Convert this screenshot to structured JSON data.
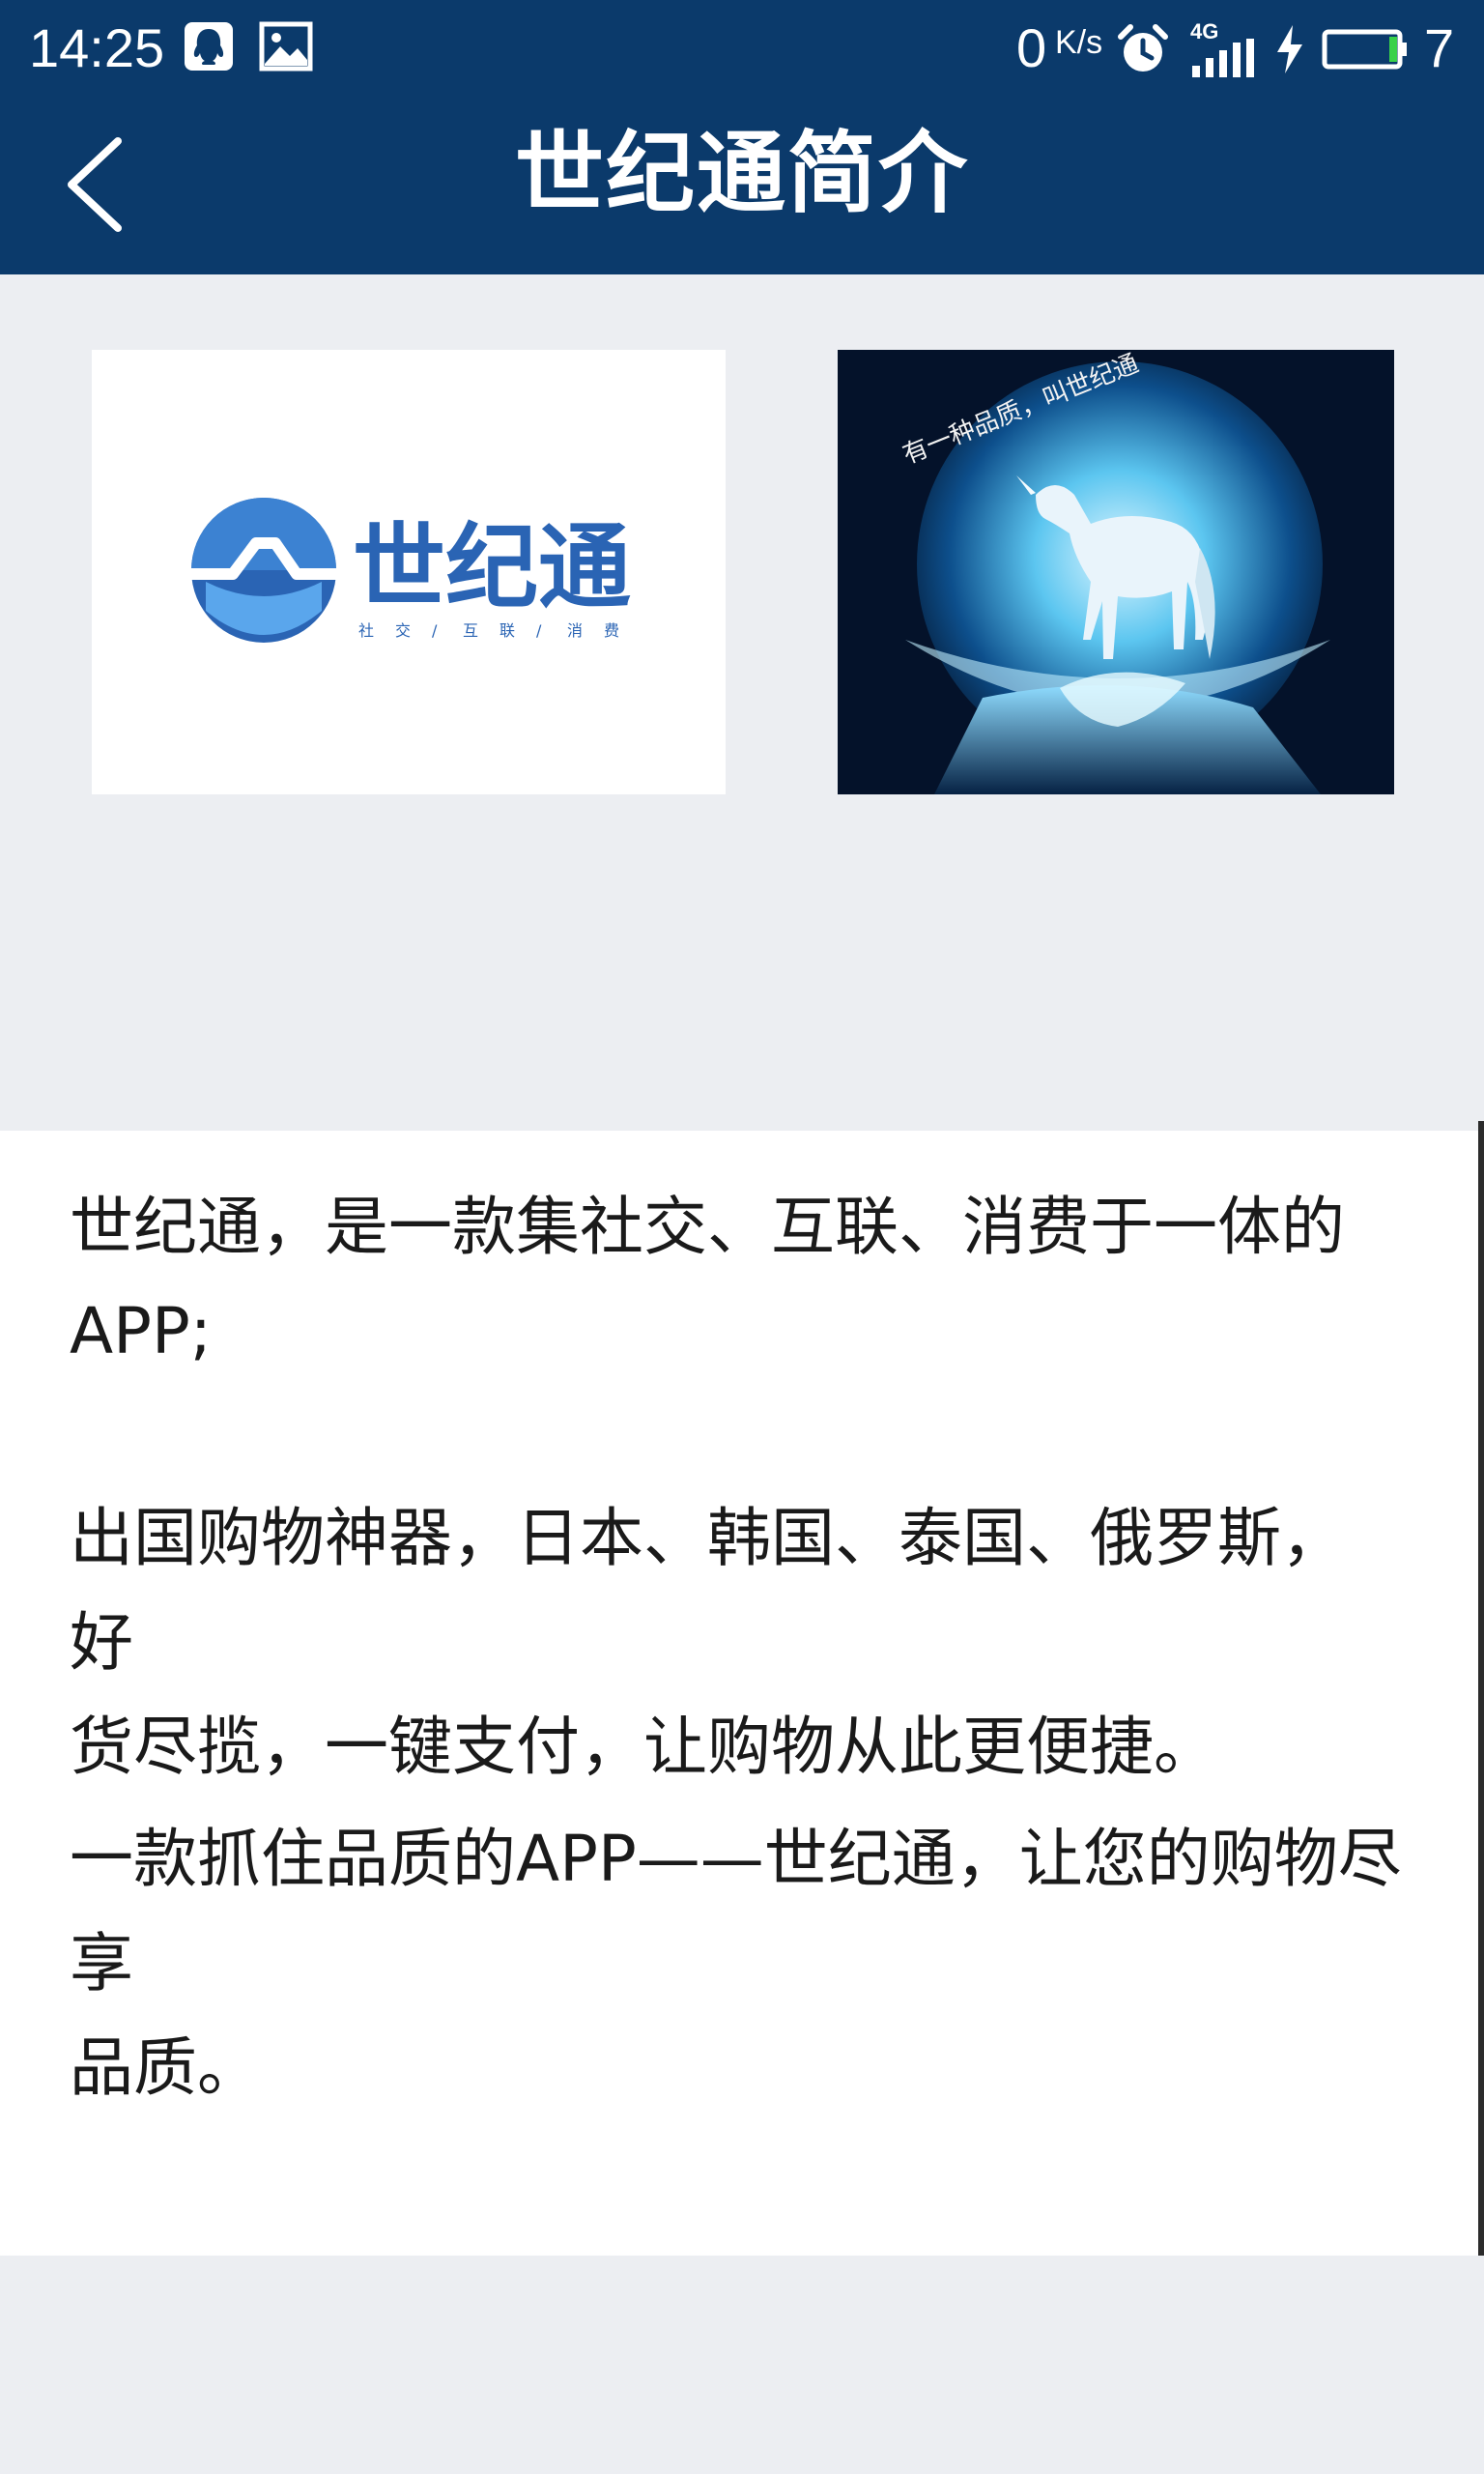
{
  "status_bar": {
    "time": "14:25",
    "net_speed": "0",
    "net_speed_unit": "K/s",
    "network": "4G",
    "battery_level": "7",
    "icons": [
      "qq-icon",
      "image-icon",
      "alarm-icon",
      "signal-icon",
      "charging-icon",
      "battery-icon"
    ]
  },
  "header": {
    "title": "世纪通简介",
    "back_icon": "chevron-left-icon"
  },
  "images": {
    "logo": {
      "brand": "世纪通",
      "tagline": [
        "社",
        "交",
        "/",
        "互",
        "联",
        "/",
        "消",
        "费"
      ]
    },
    "promo": {
      "caption": "有一种品质，叫世纪通"
    }
  },
  "intro": {
    "paragraphs": [
      [
        "世纪通，是一款集社交、互联、消费于一体的",
        "APP;"
      ],
      [
        "出国购物神器，日本、韩国、泰国、俄罗斯，好",
        "货尽揽，一键支付，让购物从此更便捷。"
      ],
      [
        "一款抓住品质的APP——世纪通，让您的购物尽享",
        "品质。"
      ]
    ]
  },
  "colors": {
    "header_bg": "#0b3a6b",
    "page_bg": "#eceef2",
    "logo_blue": "#2a64b4"
  }
}
